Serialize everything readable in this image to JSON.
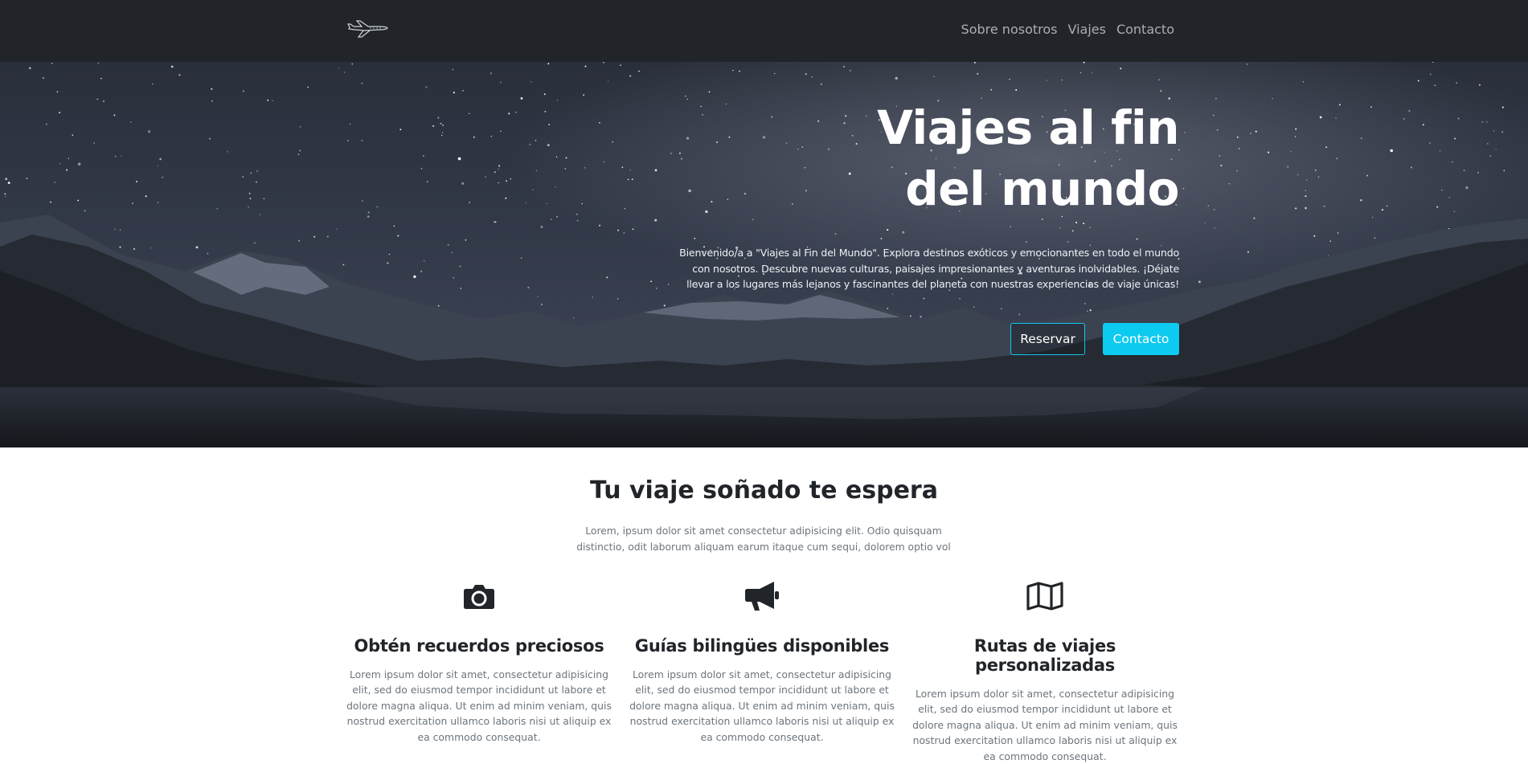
{
  "navbar": {
    "logo_icon": "airplane-logo-icon",
    "links": [
      "Sobre nosotros",
      "Viajes",
      "Contacto"
    ]
  },
  "hero": {
    "title_line1": "Viajes al fin",
    "title_line2": "del mundo",
    "text": "Bienvenido/a a \"Viajes al Fin del Mundo\". Explora destinos exóticos y emocionantes en todo el mundo con nosotros. Descubre nuevas culturas, paisajes impresionantes y aventuras inolvidables. ¡Déjate llevar a los lugares más lejanos y fascinantes del planeta con nuestras experiencias de viaje únicas!",
    "btn_reservar": "Reservar",
    "btn_contacto": "Contacto",
    "accent_color": "#0dcaf0"
  },
  "features_section": {
    "title": "Tu viaje soñado te espera",
    "subtitle": "Lorem, ipsum dolor sit amet consectetur adipisicing elit. Odio quisquam distinctio, odit laborum aliquam earum itaque cum sequi, dolorem optio vol",
    "items": [
      {
        "icon": "camera-icon",
        "title": "Obtén recuerdos preciosos",
        "text": "Lorem ipsum dolor sit amet, consectetur adipisicing elit, sed do eiusmod tempor incididunt ut labore et dolore magna aliqua. Ut enim ad minim veniam, quis nostrud exercitation ullamco laboris nisi ut aliquip ex ea commodo consequat."
      },
      {
        "icon": "megaphone-icon",
        "title": "Guías bilingües disponibles",
        "text": "Lorem ipsum dolor sit amet, consectetur adipisicing elit, sed do eiusmod tempor incididunt ut labore et dolore magna aliqua. Ut enim ad minim veniam, quis nostrud exercitation ullamco laboris nisi ut aliquip ex ea commodo consequat."
      },
      {
        "icon": "map-icon",
        "title": "Rutas de viajes personalizadas",
        "text": "Lorem ipsum dolor sit amet, consectetur adipisicing elit, sed do eiusmod tempor incididunt ut labore et dolore magna aliqua. Ut enim ad minim veniam, quis nostrud exercitation ullamco laboris nisi ut aliquip ex ea commodo consequat."
      }
    ]
  }
}
